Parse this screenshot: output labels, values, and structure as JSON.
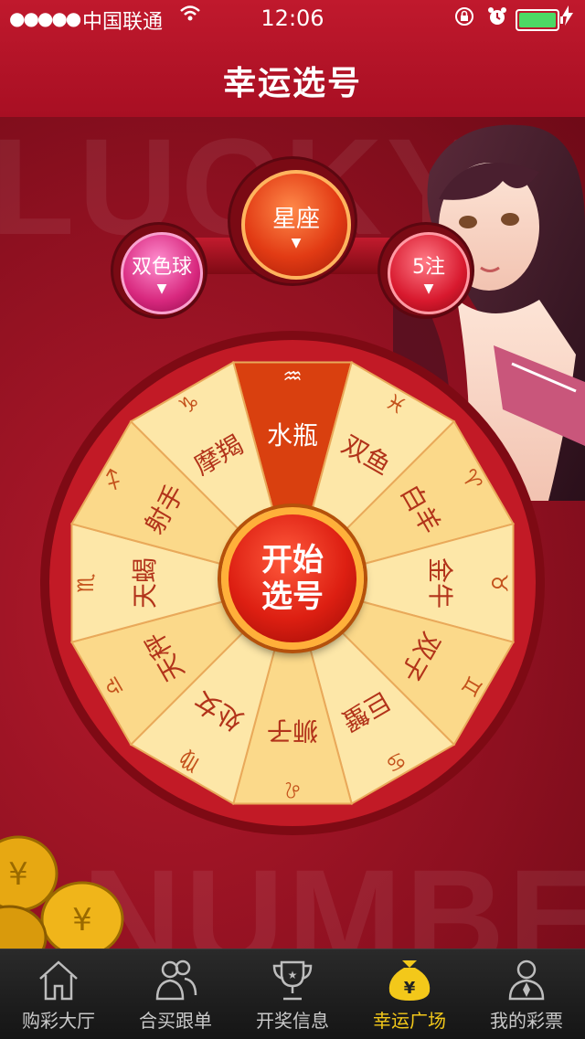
{
  "status_bar": {
    "signal": "●●●●●",
    "carrier": "中国联通",
    "wifi_icon": "wifi-icon",
    "time": "12:06",
    "battery_color": "#4cd964"
  },
  "nav": {
    "title": "幸运选号"
  },
  "background": {
    "word_top": "LUCKY",
    "word_bottom": "NUMBER"
  },
  "selectors": {
    "lottery": {
      "label": "双色球",
      "color": "#d8287e"
    },
    "mode": {
      "label": "星座",
      "color": "#e23b14"
    },
    "bets": {
      "label": "5注",
      "color": "#d8192e"
    },
    "arrow": "▼"
  },
  "wheel": {
    "selected_index": 0,
    "selected_color": "#d9400f",
    "segments": [
      {
        "name": "水瓶",
        "symbol": "♒"
      },
      {
        "name": "双鱼",
        "symbol": "♓"
      },
      {
        "name": "白羊",
        "symbol": "♈"
      },
      {
        "name": "金牛",
        "symbol": "♉"
      },
      {
        "name": "双子",
        "symbol": "♊"
      },
      {
        "name": "巨蟹",
        "symbol": "♋"
      },
      {
        "name": "狮子",
        "symbol": "♌"
      },
      {
        "name": "处女",
        "symbol": "♍"
      },
      {
        "name": "天秤",
        "symbol": "♎"
      },
      {
        "name": "天蝎",
        "symbol": "♏"
      },
      {
        "name": "射手",
        "symbol": "♐"
      },
      {
        "name": "摩羯",
        "symbol": "♑"
      }
    ]
  },
  "start_button": {
    "line1": "开始",
    "line2": "选号"
  },
  "tabbar": {
    "active_color": "#f3c81a",
    "items": [
      {
        "label": "购彩大厅",
        "icon": "house-icon"
      },
      {
        "label": "合买跟单",
        "icon": "group-icon"
      },
      {
        "label": "开奖信息",
        "icon": "trophy-icon"
      },
      {
        "label": "幸运广场",
        "icon": "money-bag-icon"
      },
      {
        "label": "我的彩票",
        "icon": "user-icon"
      }
    ],
    "active_index": 3
  }
}
